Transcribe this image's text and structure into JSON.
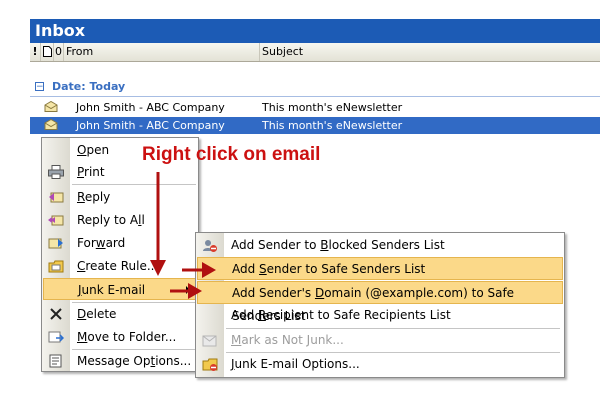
{
  "window": {
    "title": "Inbox"
  },
  "columns": {
    "importance": "!",
    "type_icon": "document-icon",
    "attachment": "0",
    "from": "From",
    "subject": "Subject"
  },
  "group": {
    "toggle": "−",
    "label": "Date: Today"
  },
  "emails": [
    {
      "from": "John Smith - ABC Company",
      "subject": "This month's eNewsletter",
      "selected": false
    },
    {
      "from": "John Smith - ABC Company",
      "subject": "This month's eNewsletter",
      "selected": true
    }
  ],
  "annotation": "Right click on email",
  "context_menu": {
    "open": {
      "pre": "",
      "key": "O",
      "post": "pen"
    },
    "print": {
      "pre": "",
      "key": "P",
      "post": "rint"
    },
    "reply": {
      "pre": "",
      "key": "R",
      "post": "eply"
    },
    "reply_all": {
      "pre": "Reply to A",
      "key": "l",
      "post": "l"
    },
    "forward": {
      "pre": "For",
      "key": "w",
      "post": "ard"
    },
    "create_rule": {
      "pre": "",
      "key": "C",
      "post": "reate Rule..."
    },
    "junk": {
      "pre": "",
      "key": "J",
      "post": "unk E-mail"
    },
    "delete": {
      "pre": "",
      "key": "D",
      "post": "elete"
    },
    "move": {
      "pre": "",
      "key": "M",
      "post": "ove to Folder..."
    },
    "options": {
      "pre": "Message Op",
      "key": "t",
      "post": "ions..."
    }
  },
  "junk_submenu": {
    "blocked": {
      "pre": "Add Sender to ",
      "key": "B",
      "post": "locked Senders List"
    },
    "safe_senders": {
      "pre": "Add ",
      "key": "S",
      "post": "ender to Safe Senders List"
    },
    "safe_domain": {
      "pre": "Add Sender's ",
      "key": "D",
      "post": "omain (@example.com) to Safe Senders List"
    },
    "safe_recipients": {
      "pre": "Add ",
      "key": "R",
      "post": "ecipient to Safe Recipients List"
    },
    "not_junk": {
      "pre": "",
      "key": "M",
      "post": "ark as Not Junk..."
    },
    "junk_options": {
      "pre": "",
      "key": "J",
      "post": "unk E-mail Options..."
    }
  },
  "colors": {
    "title_bar": "#1c5bb5",
    "selection": "#316ac5",
    "highlight": "#fbd989",
    "annotation": "#cc1111"
  }
}
